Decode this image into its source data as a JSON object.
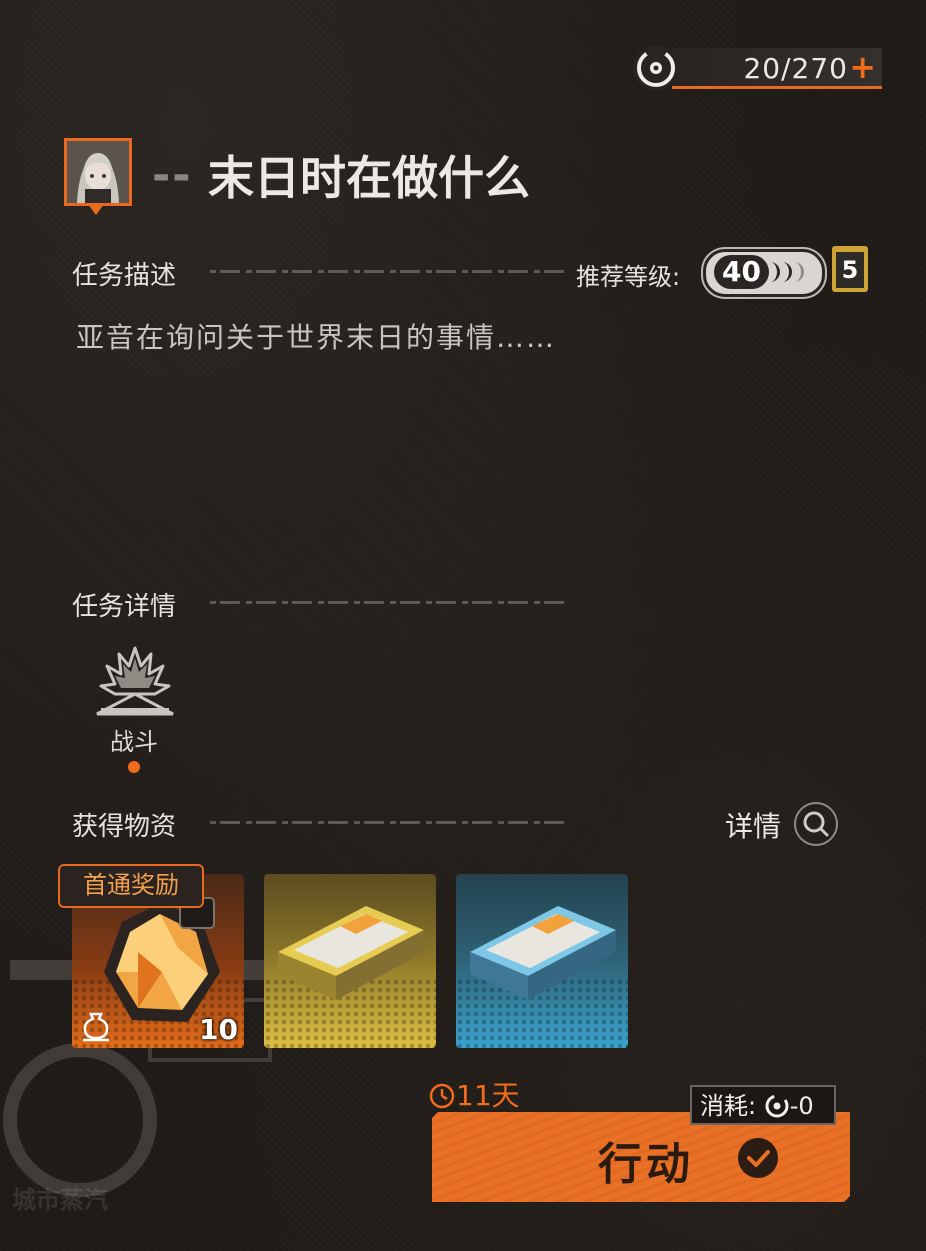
{
  "stamina": {
    "value": "20/270",
    "plus": "+"
  },
  "header": {
    "dash": "--",
    "title": "末日时在做什么"
  },
  "task_description": {
    "label": "任务描述",
    "recommended_level_label": "推荐等级:",
    "recommended_level": "40",
    "badge": "5",
    "text": "亚音在询问关于世界末日的事情……"
  },
  "task_details": {
    "label": "任务详情",
    "type_label": "战斗"
  },
  "rewards": {
    "label": "获得物资",
    "detail_label": "详情",
    "first_clear_tag": "首通奖励",
    "items": [
      {
        "name": "amber-crystal",
        "count": "10",
        "rarity_color": "#e46d1a"
      },
      {
        "name": "gold-data-card",
        "count": "",
        "rarity_color": "#ddc043"
      },
      {
        "name": "blue-data-card",
        "count": "",
        "rarity_color": "#3ba3cf"
      }
    ]
  },
  "action": {
    "timer": "11天",
    "cost_label": "消耗:",
    "cost_value": "-0",
    "button_label": "行动"
  },
  "watermark": "城市蒸汽"
}
